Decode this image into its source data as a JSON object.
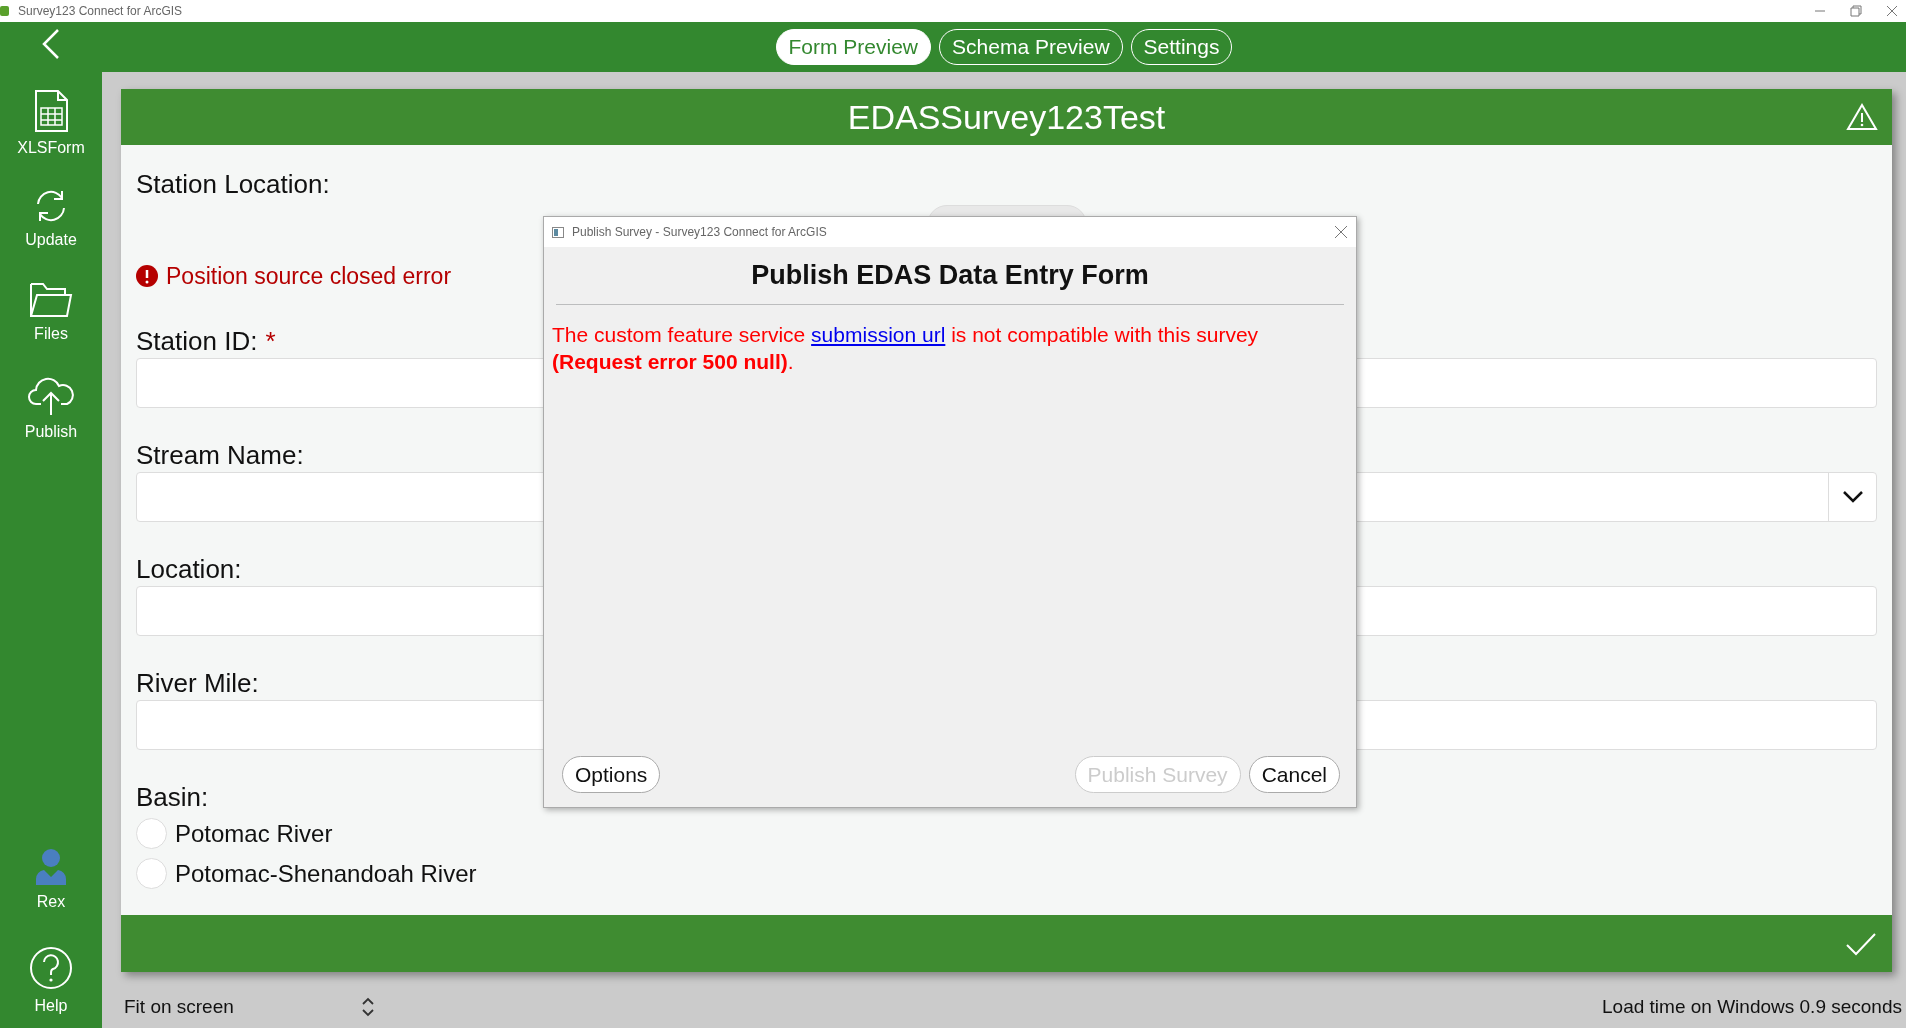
{
  "window": {
    "title": "Survey123 Connect for ArcGIS"
  },
  "sidebar": {
    "items": [
      {
        "label": "XLSForm",
        "kind": "xlsform"
      },
      {
        "label": "Update",
        "kind": "update"
      },
      {
        "label": "Files",
        "kind": "files"
      },
      {
        "label": "Publish",
        "kind": "publish"
      }
    ],
    "bottom_items": [
      {
        "label": "Rex",
        "kind": "user"
      },
      {
        "label": "Help",
        "kind": "help"
      }
    ]
  },
  "tabs": [
    {
      "label": "Form Preview",
      "selected": true
    },
    {
      "label": "Schema Preview",
      "selected": false
    },
    {
      "label": "Settings",
      "selected": false
    }
  ],
  "form": {
    "title": "EDASSurvey123Test",
    "questions": [
      {
        "kind": "geopoint",
        "label": "Station Location:",
        "error": "Position source closed error"
      },
      {
        "kind": "text",
        "label": "Station ID:",
        "required_mark": "*"
      },
      {
        "kind": "select",
        "label": "Stream Name:"
      },
      {
        "kind": "text",
        "label": "Location:"
      },
      {
        "kind": "text",
        "label": "River Mile:"
      },
      {
        "kind": "radio",
        "label": "Basin:",
        "options": [
          {
            "label": "Potomac River",
            "selected": false
          },
          {
            "label": "Potomac-Shenandoah River",
            "selected": false
          }
        ]
      }
    ]
  },
  "dialog": {
    "window_title": "Publish Survey - Survey123 Connect for ArcGIS",
    "heading": "Publish EDAS Data Entry Form",
    "message_before": "The custom feature service",
    "link": "submission url",
    "message_after": "is not compatible with this survey **(Request error 500 null)**.",
    "left_buttons": [
      {
        "label": "Options",
        "disabled": false
      }
    ],
    "right_buttons": [
      {
        "label": "Publish Survey",
        "disabled": true
      },
      {
        "label": "Cancel",
        "disabled": false
      }
    ]
  },
  "status_bar": {
    "zoom": "Fit on screen",
    "load_time": "Load time on Windows 0.9 seconds"
  }
}
